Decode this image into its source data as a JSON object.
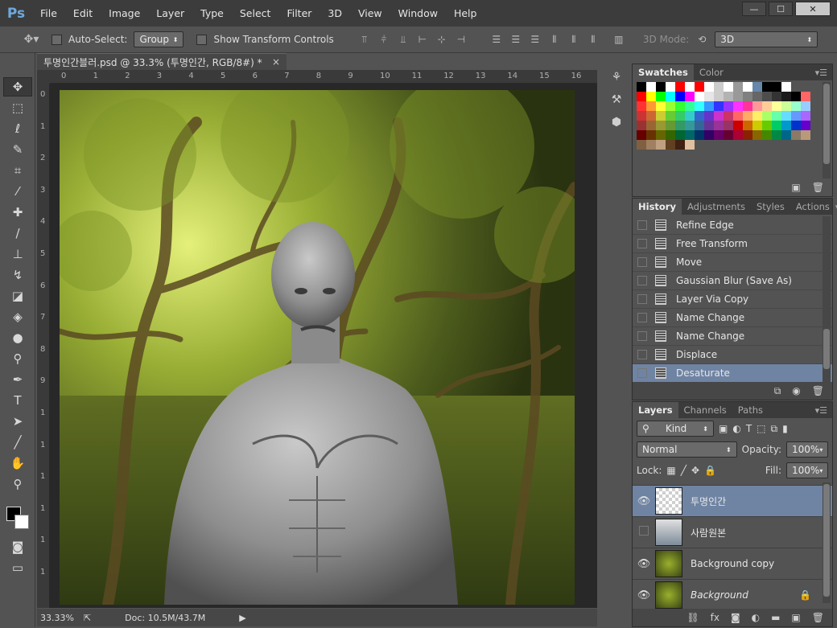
{
  "menubar": {
    "logo": "Ps",
    "items": [
      "File",
      "Edit",
      "Image",
      "Layer",
      "Type",
      "Select",
      "Filter",
      "3D",
      "View",
      "Window",
      "Help"
    ],
    "window_controls": [
      "—",
      "☐",
      "✕"
    ]
  },
  "options": {
    "auto_select_label": "Auto-Select:",
    "auto_select_value": "Group",
    "show_transform_label": "Show Transform Controls",
    "mode_label": "3D Mode:",
    "mode_value": "3D"
  },
  "document": {
    "tab_title": "투명인간블러.psd @ 33.3% (투명인간, RGB/8#) *",
    "tab_close": "×",
    "zoom": "33.33%",
    "doc_size": "Doc: 10.5M/43.7M",
    "ruler_h": [
      "0",
      "1",
      "2",
      "3",
      "4",
      "5",
      "6",
      "7",
      "8",
      "9",
      "10",
      "11",
      "12",
      "13",
      "14",
      "15",
      "16"
    ],
    "ruler_v": [
      "0",
      "1",
      "2",
      "3",
      "4",
      "5",
      "6",
      "7",
      "8",
      "9",
      "1",
      "1",
      "1",
      "1",
      "1",
      "1"
    ]
  },
  "swatches": {
    "tabs": [
      "Swatches",
      "Color"
    ],
    "rows": [
      [
        "#000000",
        "#ffffff",
        "#000000",
        "#ffffff",
        "#ff0000",
        "#ffffff",
        "#ff0000",
        "#ffffff",
        "#cccccc",
        "#ffffff",
        "#999999",
        "#ffffff",
        "#6688aa",
        "#000000",
        "#000000",
        "#ffffff"
      ],
      [
        "#ff0000",
        "#ffff00",
        "#00ff00",
        "#00ffff",
        "#0000ff",
        "#ff00ff",
        "#ffffff",
        "#e6e6e6",
        "#cccccc",
        "#b3b3b3",
        "#999999",
        "#808080",
        "#666666",
        "#4d4d4d",
        "#333333",
        "#1a1a1a",
        "#000000",
        "#ff6666"
      ],
      [
        "#ff3333",
        "#ff9933",
        "#ffff33",
        "#99ff33",
        "#33ff33",
        "#33ff99",
        "#33ffff",
        "#3399ff",
        "#3333ff",
        "#9933ff",
        "#ff33ff",
        "#ff3399",
        "#ff9999",
        "#ffcc99",
        "#ffff99",
        "#ccff99",
        "#99ffcc",
        "#99ccff"
      ],
      [
        "#cc3333",
        "#cc6633",
        "#cccc33",
        "#66cc33",
        "#33cc66",
        "#33cccc",
        "#3366cc",
        "#6633cc",
        "#cc33cc",
        "#cc3366",
        "#ff6666",
        "#ffaa66",
        "#ffee66",
        "#aaff66",
        "#66ffaa",
        "#66ddff",
        "#6699ff",
        "#aa66ff"
      ],
      [
        "#993333",
        "#996633",
        "#999933",
        "#669933",
        "#339966",
        "#339999",
        "#336699",
        "#663399",
        "#993399",
        "#993366",
        "#cc0000",
        "#cc6600",
        "#cccc00",
        "#66cc00",
        "#00cc66",
        "#0099cc",
        "#0033cc",
        "#6600cc"
      ],
      [
        "#660000",
        "#663300",
        "#666600",
        "#336600",
        "#006633",
        "#006666",
        "#003366",
        "#330066",
        "#660066",
        "#660033",
        "#aa0033",
        "#882200",
        "#886600",
        "#448800",
        "#008844",
        "#006688",
        "#8a7a66",
        "#b89a7a"
      ],
      [
        "#806040",
        "#a08060",
        "#c0a080",
        "#604020",
        "#402010",
        "#e0c0a0"
      ]
    ]
  },
  "history": {
    "tabs": [
      "History",
      "Adjustments",
      "Styles",
      "Actions"
    ],
    "items": [
      "Refine Edge",
      "Free Transform",
      "Move",
      "Gaussian Blur (Save As)",
      "Layer Via Copy",
      "Name Change",
      "Name Change",
      "Displace",
      "Desaturate"
    ]
  },
  "layers": {
    "tabs": [
      "Layers",
      "Channels",
      "Paths"
    ],
    "kind": "Kind",
    "blend_mode": "Normal",
    "opacity_label": "Opacity:",
    "opacity_value": "100%",
    "lock_label": "Lock:",
    "fill_label": "Fill:",
    "fill_value": "100%",
    "items": [
      {
        "name": "투명인간",
        "visible": true
      },
      {
        "name": "사람원본",
        "visible": false
      },
      {
        "name": "Background copy",
        "visible": true
      },
      {
        "name": "Background",
        "visible": true
      }
    ]
  }
}
